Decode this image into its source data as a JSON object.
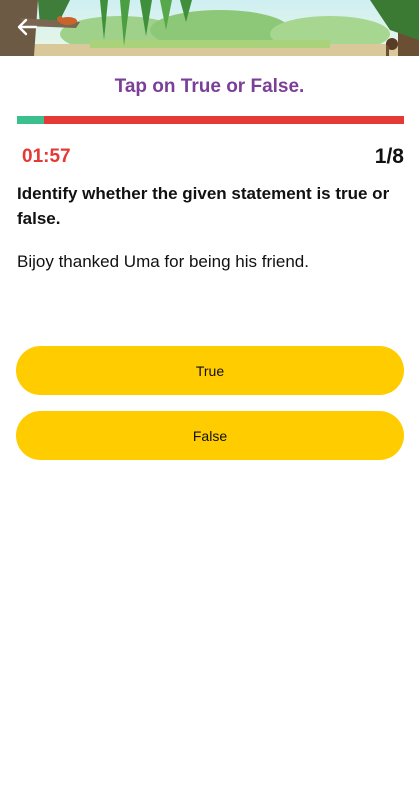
{
  "header": {
    "back_icon": "arrow-left-icon"
  },
  "quiz": {
    "title": "Tap on True or False.",
    "progress_fraction": 0.125,
    "timer": "01:57",
    "counter": "1/8",
    "instruction": "Identify whether the given statement is true or false.",
    "statement": "Bijoy thanked Uma for being his friend.",
    "options": [
      {
        "label": "True"
      },
      {
        "label": "False"
      }
    ]
  },
  "colors": {
    "title": "#7b3f98",
    "progress_track": "#e53935",
    "progress_fill": "#3bbf8f",
    "timer": "#e53935",
    "option_bg": "#ffcc00"
  }
}
